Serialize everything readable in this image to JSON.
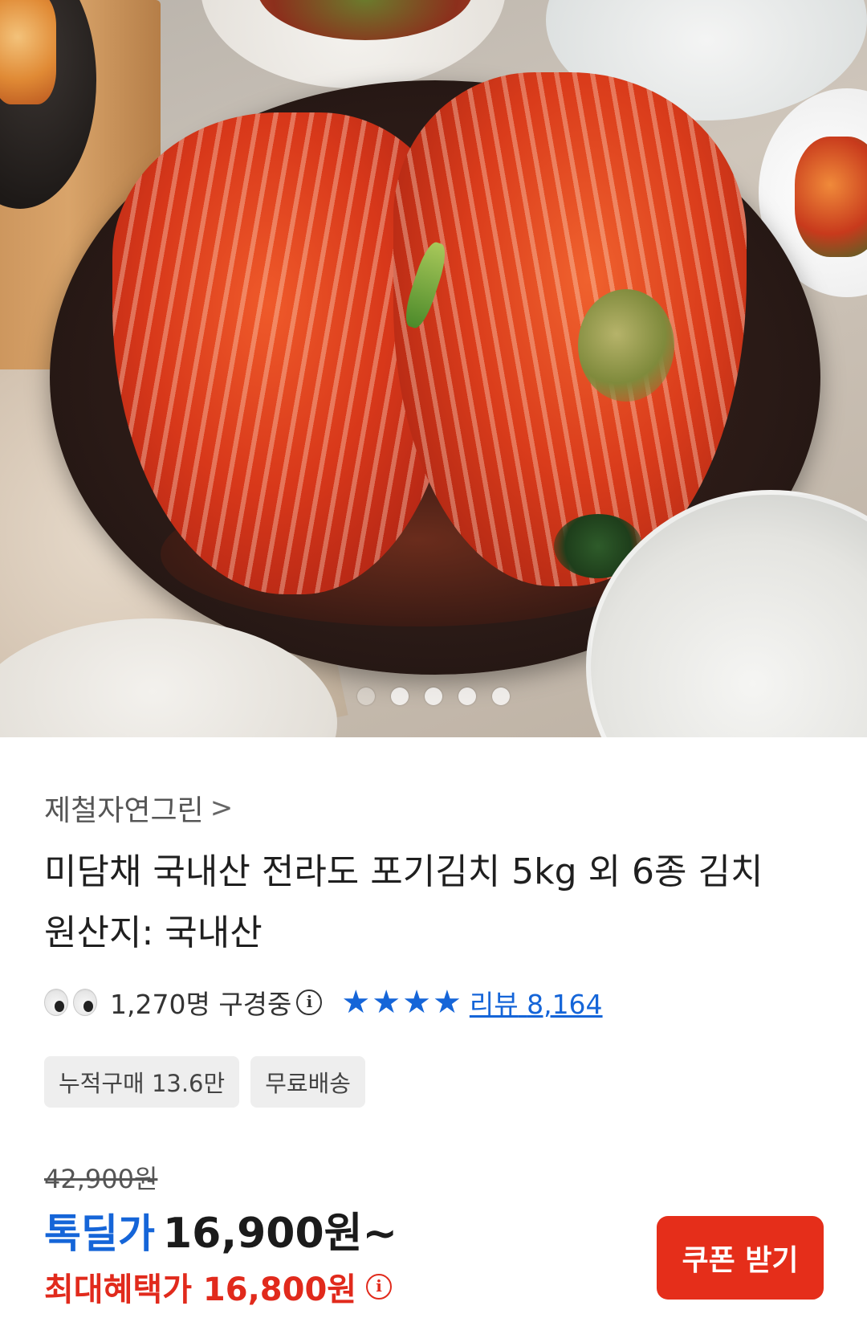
{
  "carousel": {
    "slide_count": 5,
    "active_index": 0,
    "image_alt": "kimchi-photo"
  },
  "product": {
    "store_name": "제철자연그린",
    "store_chevron": ">",
    "title_line1": "미담채 국내산 전라도 포기김치 5kg 외 6종 김치",
    "title_line2": "원산지: 국내산"
  },
  "stats": {
    "viewers": "1,270명 구경중",
    "info_glyph": "i",
    "rating_stars": 4,
    "review_label": "리뷰",
    "review_count": "8,164"
  },
  "tags": [
    "누적구매 13.6만",
    "무료배송"
  ],
  "pricing": {
    "original_price": "42,900원",
    "deal_label": "톡딜가",
    "deal_price": "16,900원~",
    "max_benefit_text": "최대혜택가 16,800원",
    "info_glyph": "i"
  },
  "coupon_button": "쿠폰 받기",
  "colors": {
    "accent_blue": "#1565d8",
    "accent_red": "#e12a1c",
    "coupon_bg": "#e52e1a"
  }
}
